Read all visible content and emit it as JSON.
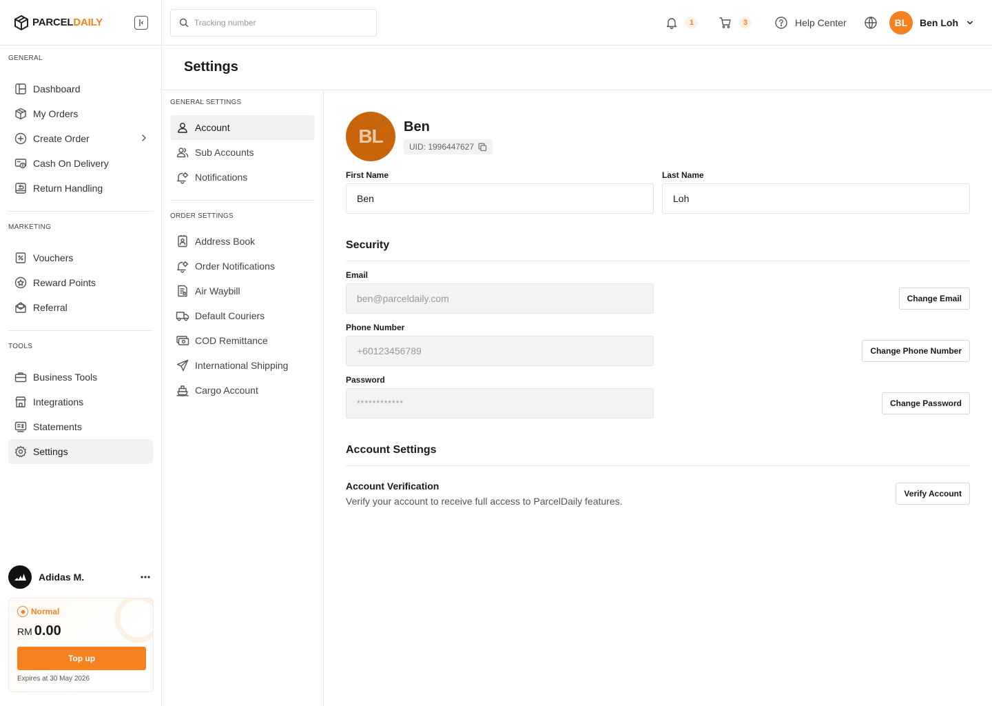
{
  "brand": {
    "name_part1": "PARCEL",
    "name_part2": "DAILY",
    "accent": "#f5811f"
  },
  "sidebar": {
    "sections": [
      {
        "title": "GENERAL",
        "items": [
          {
            "label": "Dashboard",
            "icon": "dashboard-icon"
          },
          {
            "label": "My Orders",
            "icon": "box-icon"
          },
          {
            "label": "Create Order",
            "icon": "plus-circle-icon",
            "has_submenu": true
          },
          {
            "label": "Cash On Delivery",
            "icon": "cash-icon"
          },
          {
            "label": "Return Handling",
            "icon": "return-icon"
          }
        ]
      },
      {
        "title": "MARKETING",
        "items": [
          {
            "label": "Vouchers",
            "icon": "voucher-icon"
          },
          {
            "label": "Reward Points",
            "icon": "reward-icon"
          },
          {
            "label": "Referral",
            "icon": "referral-icon"
          }
        ]
      },
      {
        "title": "TOOLS",
        "items": [
          {
            "label": "Business Tools",
            "icon": "briefcase-icon"
          },
          {
            "label": "Integrations",
            "icon": "integrations-icon"
          },
          {
            "label": "Statements",
            "icon": "statement-icon"
          },
          {
            "label": "Settings",
            "icon": "gear-icon",
            "active": true
          }
        ]
      }
    ],
    "merchant": {
      "name": "Adidas M."
    },
    "wallet": {
      "tier": "Normal",
      "currency": "RM",
      "balance": "0.00",
      "topup_label": "Top up",
      "expiry": "Expires at 30 May 2026"
    }
  },
  "topbar": {
    "search_placeholder": "Tracking number",
    "notification_count": "1",
    "cart_count": "3",
    "help_label": "Help Center",
    "user_initials": "BL",
    "user_name": "Ben Loh"
  },
  "page": {
    "title": "Settings"
  },
  "subnav": {
    "general_title": "GENERAL SETTINGS",
    "general_items": [
      {
        "label": "Account",
        "icon": "user-icon",
        "active": true
      },
      {
        "label": "Sub Accounts",
        "icon": "users-icon"
      },
      {
        "label": "Notifications",
        "icon": "bell-gear-icon"
      }
    ],
    "order_title": "ORDER SETTINGS",
    "order_items": [
      {
        "label": "Address Book",
        "icon": "address-book-icon"
      },
      {
        "label": "Order Notifications",
        "icon": "bell-gear-icon"
      },
      {
        "label": "Air Waybill",
        "icon": "waybill-icon"
      },
      {
        "label": "Default Couriers",
        "icon": "truck-icon"
      },
      {
        "label": "COD Remittance",
        "icon": "remittance-icon"
      },
      {
        "label": "International Shipping",
        "icon": "plane-icon"
      },
      {
        "label": "Cargo Account",
        "icon": "cargo-icon"
      }
    ]
  },
  "account": {
    "avatar_initials": "BL",
    "display_name": "Ben",
    "uid": "UID: 1996447627",
    "first_name_label": "First Name",
    "first_name": "Ben",
    "last_name_label": "Last Name",
    "last_name": "Loh",
    "security_title": "Security",
    "email_label": "Email",
    "email_value": "ben@parceldaily.com",
    "change_email_label": "Change Email",
    "phone_label": "Phone Number",
    "phone_value": "+60123456789",
    "change_phone_label": "Change Phone Number",
    "password_label": "Password",
    "password_value": "************",
    "change_password_label": "Change Password",
    "account_settings_title": "Account Settings",
    "verification_title": "Account Verification",
    "verification_desc": "Verify your account to receive full access to ParcelDaily features.",
    "verify_button": "Verify Account"
  }
}
